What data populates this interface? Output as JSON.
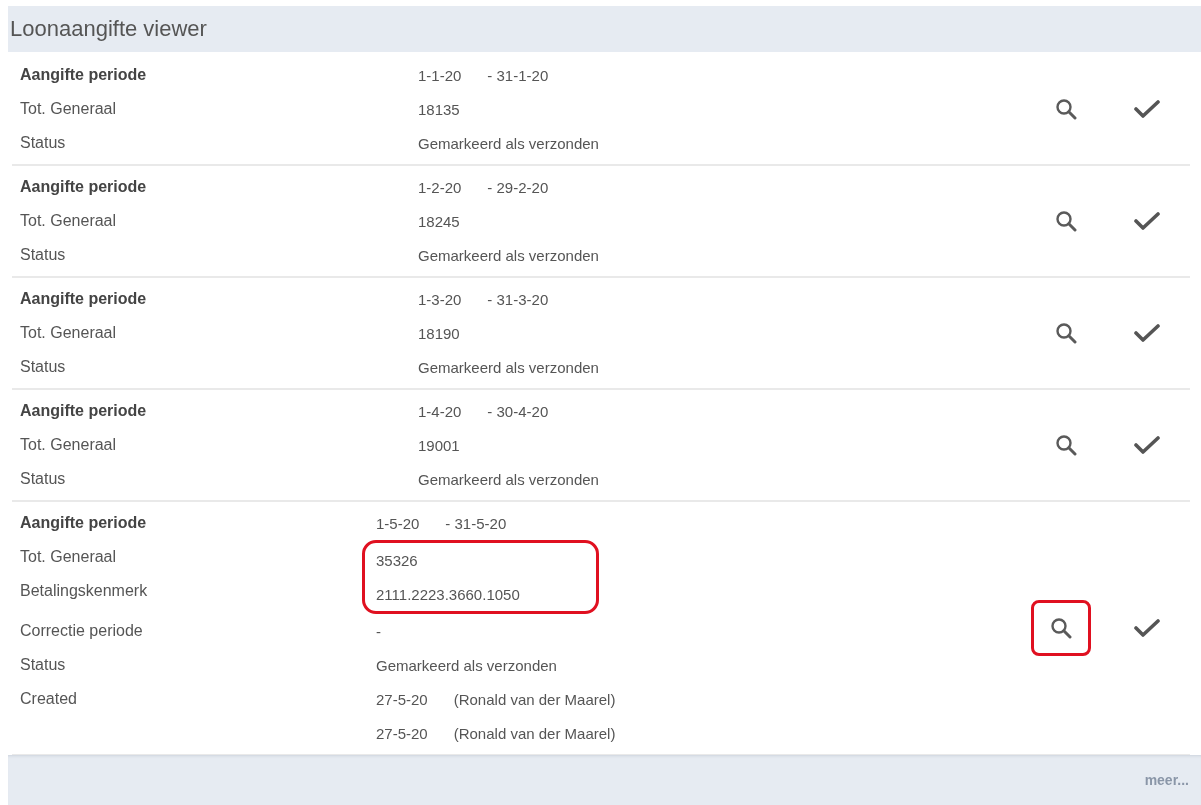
{
  "window": {
    "title": "Loonaangifte viewer"
  },
  "entries": [
    {
      "kind": "summary",
      "fields": [
        {
          "label": "Aangifte periode",
          "emphasis": true,
          "highlighted": false,
          "lines": [
            [
              "1-1-20",
              "- 31-1-20"
            ]
          ]
        },
        {
          "label": "Tot. Generaal",
          "emphasis": false,
          "highlighted": false,
          "lines": [
            [
              "18135"
            ]
          ]
        },
        {
          "label": "Status",
          "emphasis": false,
          "highlighted": false,
          "lines": [
            [
              "Gemarkeerd als verzonden"
            ]
          ]
        }
      ],
      "search_highlighted": false
    },
    {
      "kind": "summary",
      "fields": [
        {
          "label": "Aangifte periode",
          "emphasis": true,
          "highlighted": false,
          "lines": [
            [
              "1-2-20",
              "- 29-2-20"
            ]
          ]
        },
        {
          "label": "Tot. Generaal",
          "emphasis": false,
          "highlighted": false,
          "lines": [
            [
              "18245"
            ]
          ]
        },
        {
          "label": "Status",
          "emphasis": false,
          "highlighted": false,
          "lines": [
            [
              "Gemarkeerd als verzonden"
            ]
          ]
        }
      ],
      "search_highlighted": false
    },
    {
      "kind": "summary",
      "fields": [
        {
          "label": "Aangifte periode",
          "emphasis": true,
          "highlighted": false,
          "lines": [
            [
              "1-3-20",
              "- 31-3-20"
            ]
          ]
        },
        {
          "label": "Tot. Generaal",
          "emphasis": false,
          "highlighted": false,
          "lines": [
            [
              "18190"
            ]
          ]
        },
        {
          "label": "Status",
          "emphasis": false,
          "highlighted": false,
          "lines": [
            [
              "Gemarkeerd als verzonden"
            ]
          ]
        }
      ],
      "search_highlighted": false
    },
    {
      "kind": "summary",
      "fields": [
        {
          "label": "Aangifte periode",
          "emphasis": true,
          "highlighted": false,
          "lines": [
            [
              "1-4-20",
              "- 30-4-20"
            ]
          ]
        },
        {
          "label": "Tot. Generaal",
          "emphasis": false,
          "highlighted": false,
          "lines": [
            [
              "19001"
            ]
          ]
        },
        {
          "label": "Status",
          "emphasis": false,
          "highlighted": false,
          "lines": [
            [
              "Gemarkeerd als verzonden"
            ]
          ]
        }
      ],
      "search_highlighted": false
    },
    {
      "kind": "detail",
      "fields": [
        {
          "label": "Aangifte periode",
          "emphasis": true,
          "highlighted": false,
          "lines": [
            [
              "1-5-20",
              "- 31-5-20"
            ]
          ]
        },
        {
          "label": "Tot. Generaal",
          "emphasis": false,
          "highlighted": true,
          "lines": [
            [
              "35326"
            ]
          ]
        },
        {
          "label": "Betalingskenmerk",
          "emphasis": false,
          "highlighted": true,
          "lines": [
            [
              "2111.2223.3660.1050"
            ]
          ]
        },
        {
          "label": "Correctie periode",
          "emphasis": false,
          "highlighted": false,
          "lines": [
            [
              "-"
            ]
          ]
        },
        {
          "label": "Status",
          "emphasis": false,
          "highlighted": false,
          "lines": [
            [
              "Gemarkeerd als verzonden"
            ]
          ]
        },
        {
          "label": "Created",
          "emphasis": false,
          "highlighted": false,
          "lines": [
            [
              "27-5-20",
              "(Ronald van der Maarel)"
            ],
            [
              "27-5-20",
              "(Ronald van der Maarel)"
            ]
          ]
        }
      ],
      "search_highlighted": true
    }
  ],
  "footer": {
    "link": "meer..."
  }
}
